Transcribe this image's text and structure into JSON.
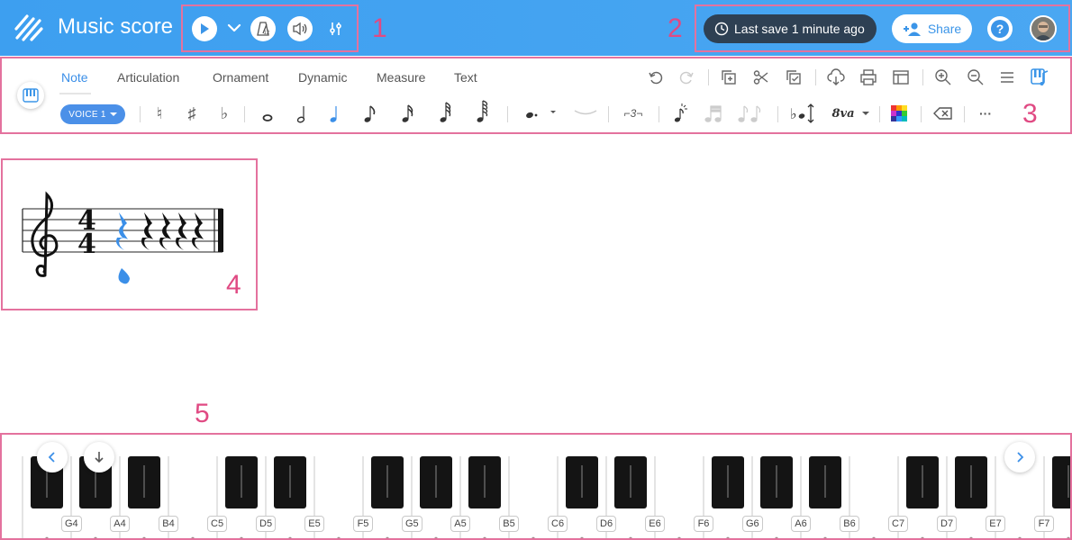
{
  "header": {
    "title": "Music score",
    "save_status": "Last save 1 minute ago",
    "share_label": "Share"
  },
  "annotations": [
    "1",
    "2",
    "3",
    "4",
    "5"
  ],
  "tabs": [
    {
      "label": "Note",
      "active": true
    },
    {
      "label": "Articulation",
      "active": false
    },
    {
      "label": "Ornament",
      "active": false
    },
    {
      "label": "Dynamic",
      "active": false
    },
    {
      "label": "Measure",
      "active": false
    },
    {
      "label": "Text",
      "active": false
    }
  ],
  "toolbar": {
    "voice_label": "VOICE 1",
    "tuplet_label": "3",
    "octave_label": "8va",
    "natural": "♮",
    "sharp": "♯",
    "flat": "♭",
    "more": "···"
  },
  "icons": {
    "play": "play-icon",
    "dropdown": "chevron-down-icon",
    "metronome": "metronome-icon",
    "volume": "volume-icon",
    "mixer": "mixer-icon",
    "clock": "clock-icon",
    "share": "add-person-icon",
    "help": "help-icon",
    "undo": "undo-icon",
    "redo": "redo-icon",
    "copy": "copy-icon",
    "cut": "scissors-icon",
    "paste": "paste-icon",
    "download": "download-icon",
    "print": "print-icon",
    "layout": "layout-icon",
    "zoom_in": "zoom-in-icon",
    "zoom_out": "zoom-out-icon",
    "menu": "hamburger-menu-icon",
    "instrument": "instrument-icon"
  },
  "piano": {
    "labels": [
      "G4",
      "A4",
      "B4",
      "C5",
      "D5",
      "E5",
      "F5",
      "G5",
      "A5",
      "B5",
      "C6",
      "D6",
      "E6",
      "F6",
      "G6",
      "A6",
      "B6",
      "C7",
      "D7",
      "E7",
      "F7"
    ]
  },
  "colors": {
    "header_blue": "#3d9ff0",
    "accent_blue": "#4b90e8",
    "annotation_pink": "#e04a83",
    "save_pill": "#2e4053"
  }
}
